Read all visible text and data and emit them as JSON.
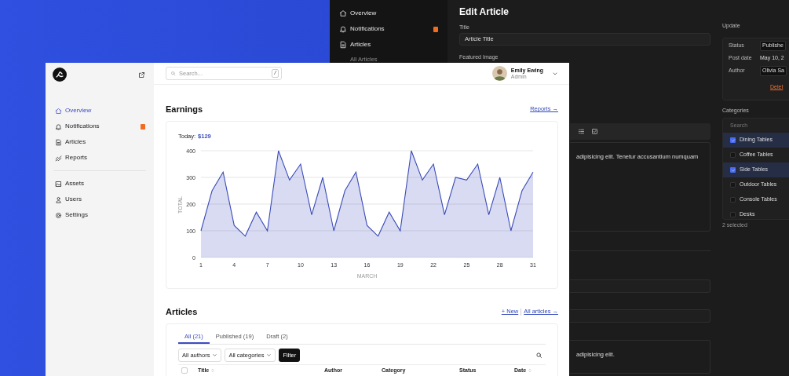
{
  "dark_window": {
    "sidebar": {
      "items": [
        {
          "label": "Overview",
          "badge": false
        },
        {
          "label": "Notifications",
          "badge": true
        },
        {
          "label": "Articles",
          "badge": false,
          "children": [
            {
              "label": "All Articles"
            }
          ]
        }
      ]
    },
    "title": "Edit Article",
    "title_field": {
      "label": "Title",
      "value": "Article Title"
    },
    "featured_image_label": "Featured Image",
    "body_text": "adipisicing elit. Tenetur accusantium numquam",
    "excerpt_text": "adipisicing elit.",
    "update": {
      "label": "Update",
      "rows": [
        {
          "label": "Status",
          "value": "Publishe",
          "kind": "select"
        },
        {
          "label": "Post date",
          "value": "May 10, 2",
          "kind": "text"
        },
        {
          "label": "Author",
          "value": "Olivia Sa",
          "kind": "select"
        }
      ],
      "delete_link": "Delet"
    },
    "categories": {
      "label": "Categories",
      "search_placeholder": "Search",
      "items": [
        {
          "label": "Dining Tables",
          "checked": true
        },
        {
          "label": "Coffee Tables",
          "checked": false
        },
        {
          "label": "Side Tables",
          "checked": true
        },
        {
          "label": "Outdoor Tables",
          "checked": false
        },
        {
          "label": "Console Tables",
          "checked": false
        },
        {
          "label": "Desks",
          "checked": false
        }
      ],
      "summary": "2 selected"
    }
  },
  "light_window": {
    "sidebar": {
      "groups": [
        {
          "items": [
            {
              "label": "Overview",
              "selected": true,
              "badge": false
            },
            {
              "label": "Notifications",
              "selected": false,
              "badge": true
            },
            {
              "label": "Articles",
              "selected": false,
              "badge": false
            },
            {
              "label": "Reports",
              "selected": false,
              "badge": false
            }
          ]
        },
        {
          "items": [
            {
              "label": "Assets",
              "selected": false,
              "badge": false
            },
            {
              "label": "Users",
              "selected": false,
              "badge": false
            },
            {
              "label": "Settings",
              "selected": false,
              "badge": false
            }
          ]
        }
      ]
    },
    "search": {
      "placeholder": "Search...",
      "shortcut": "/"
    },
    "user": {
      "name": "Emily Ewing",
      "role": "Admin"
    },
    "earnings": {
      "title": "Earnings",
      "link": "Reports →",
      "today_label": "Today:",
      "today_value": "$129",
      "chart_data": {
        "type": "area",
        "xlabel": "MARCH",
        "ylabel": "TOTAL",
        "x": [
          1,
          2,
          3,
          4,
          5,
          6,
          7,
          8,
          9,
          10,
          11,
          12,
          13,
          14,
          15,
          16,
          17,
          18,
          19,
          20,
          21,
          22,
          23,
          24,
          25,
          26,
          27,
          28,
          29,
          30,
          31
        ],
        "series": [
          {
            "color": "#3a4bb8",
            "values": [
              100,
              250,
              320,
              120,
              80,
              170,
              100,
              400,
              290,
              350,
              160,
              300,
              100,
              250,
              320,
              120,
              80,
              170,
              100,
              400,
              290,
              350,
              160,
              300,
              290,
              350,
              160,
              300,
              100,
              250,
              320
            ]
          }
        ],
        "xlim": [
          1,
          31
        ],
        "ylim": [
          0,
          400
        ],
        "xticks": [
          1,
          4,
          7,
          10,
          13,
          16,
          19,
          22,
          25,
          28,
          31
        ],
        "yticks": [
          0,
          100,
          200,
          300,
          400
        ],
        "grid": true
      }
    },
    "articles": {
      "title": "Articles",
      "new_link": "+ New",
      "all_link": "All articles →",
      "tabs": [
        {
          "label": "All (21)",
          "selected": true
        },
        {
          "label": "Published (19)",
          "selected": false
        },
        {
          "label": "Draft (2)",
          "selected": false
        }
      ],
      "filters": [
        "All authors",
        "All categories"
      ],
      "filter_button": "Filter",
      "select_all": {
        "checked": false
      },
      "columns": [
        {
          "label": "Title",
          "sortable": true
        },
        {
          "label": "Author",
          "sortable": false
        },
        {
          "label": "Category",
          "sortable": false
        },
        {
          "label": "Status",
          "sortable": false
        },
        {
          "label": "Date",
          "sortable": true
        }
      ]
    }
  }
}
